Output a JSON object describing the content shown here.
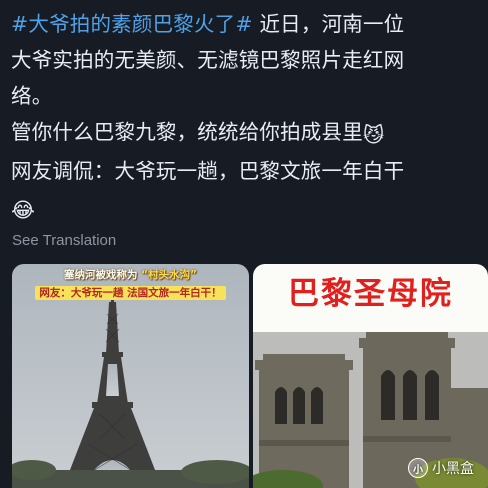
{
  "post": {
    "hashtag": "#大爷拍的素颜巴黎火了#",
    "line1_rest": " 近日，河南一位",
    "line2": "大爷实拍的无美颜、无滤镜巴黎照片走红网",
    "line3": "络。",
    "line4": "管你什么巴黎九黎，统统给你拍成县里",
    "line4_emoji": "😼",
    "line5": "网友调侃：大爷玩一趟，巴黎文旅一年白干",
    "line6_emoji": "😂"
  },
  "see_translation": "See Translation",
  "media": {
    "left": {
      "caption1_a": "塞纳河被戏称为",
      "caption1_b": "“村头水沟”",
      "caption2": "网友：大爷玩一趟 法国文旅一年白干！"
    },
    "right": {
      "title": "巴黎圣母院"
    }
  },
  "watermark": {
    "logo_glyph": "小",
    "text": "小黑盒"
  },
  "colors": {
    "background": "#171b24",
    "hashtag": "#4fa2e8",
    "body_text": "#e9edf3",
    "muted": "#8d95a2",
    "red_title": "#e11f1c"
  },
  "icons": [
    "cat-face-emoji",
    "tears-of-joy-emoji",
    "heybox-logo-icon"
  ]
}
